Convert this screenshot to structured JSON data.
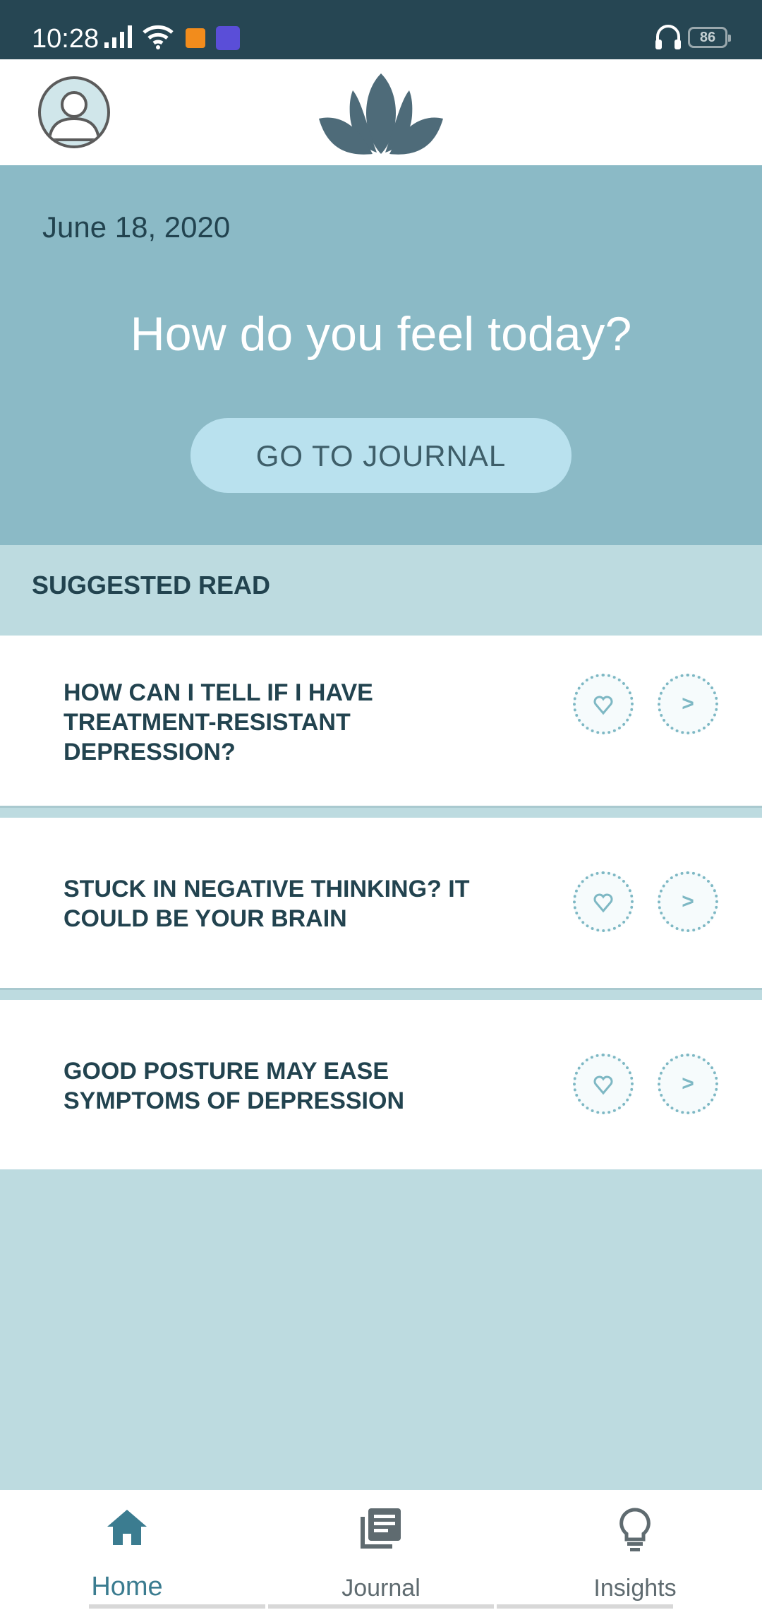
{
  "status_bar": {
    "time": "10:28",
    "battery": "86",
    "icons": [
      "signal-icon",
      "wifi-icon",
      "app-notification-icon",
      "app-notification-icon",
      "headset-icon",
      "battery-icon"
    ]
  },
  "header": {
    "avatar_icon": "user-avatar-icon",
    "logo_icon": "lotus-logo-icon"
  },
  "hero": {
    "date": "June 18, 2020",
    "question": "How do you feel today?",
    "journal_button": "GO TO JOURNAL"
  },
  "suggested": {
    "title": "SUGGESTED READ",
    "articles": [
      {
        "line1": "HOW CAN I TELL IF I HAVE",
        "line2": "TREATMENT-RESISTANT",
        "line3": "DEPRESSION?",
        "open_label": ">"
      },
      {
        "line1": "STUCK IN NEGATIVE THINKING? IT",
        "line2": "COULD BE YOUR BRAIN",
        "open_label": ">"
      },
      {
        "line1": "GOOD POSTURE MAY EASE",
        "line2": "SYMPTOMS OF DEPRESSION",
        "open_label": ">"
      }
    ]
  },
  "bottom_nav": {
    "items": [
      {
        "label": "Home",
        "icon": "home-icon",
        "active": true
      },
      {
        "label": "Journal",
        "icon": "journal-icon",
        "active": false
      },
      {
        "label": "Insights",
        "icon": "lightbulb-icon",
        "active": false
      }
    ]
  },
  "colors": {
    "status_bar": "#264653",
    "hero_bg": "#8bbac6",
    "section_bg": "#bddbe0",
    "button_bg": "#b9e1ee",
    "text_dark": "#22434f",
    "accent": "#3b7c90"
  }
}
